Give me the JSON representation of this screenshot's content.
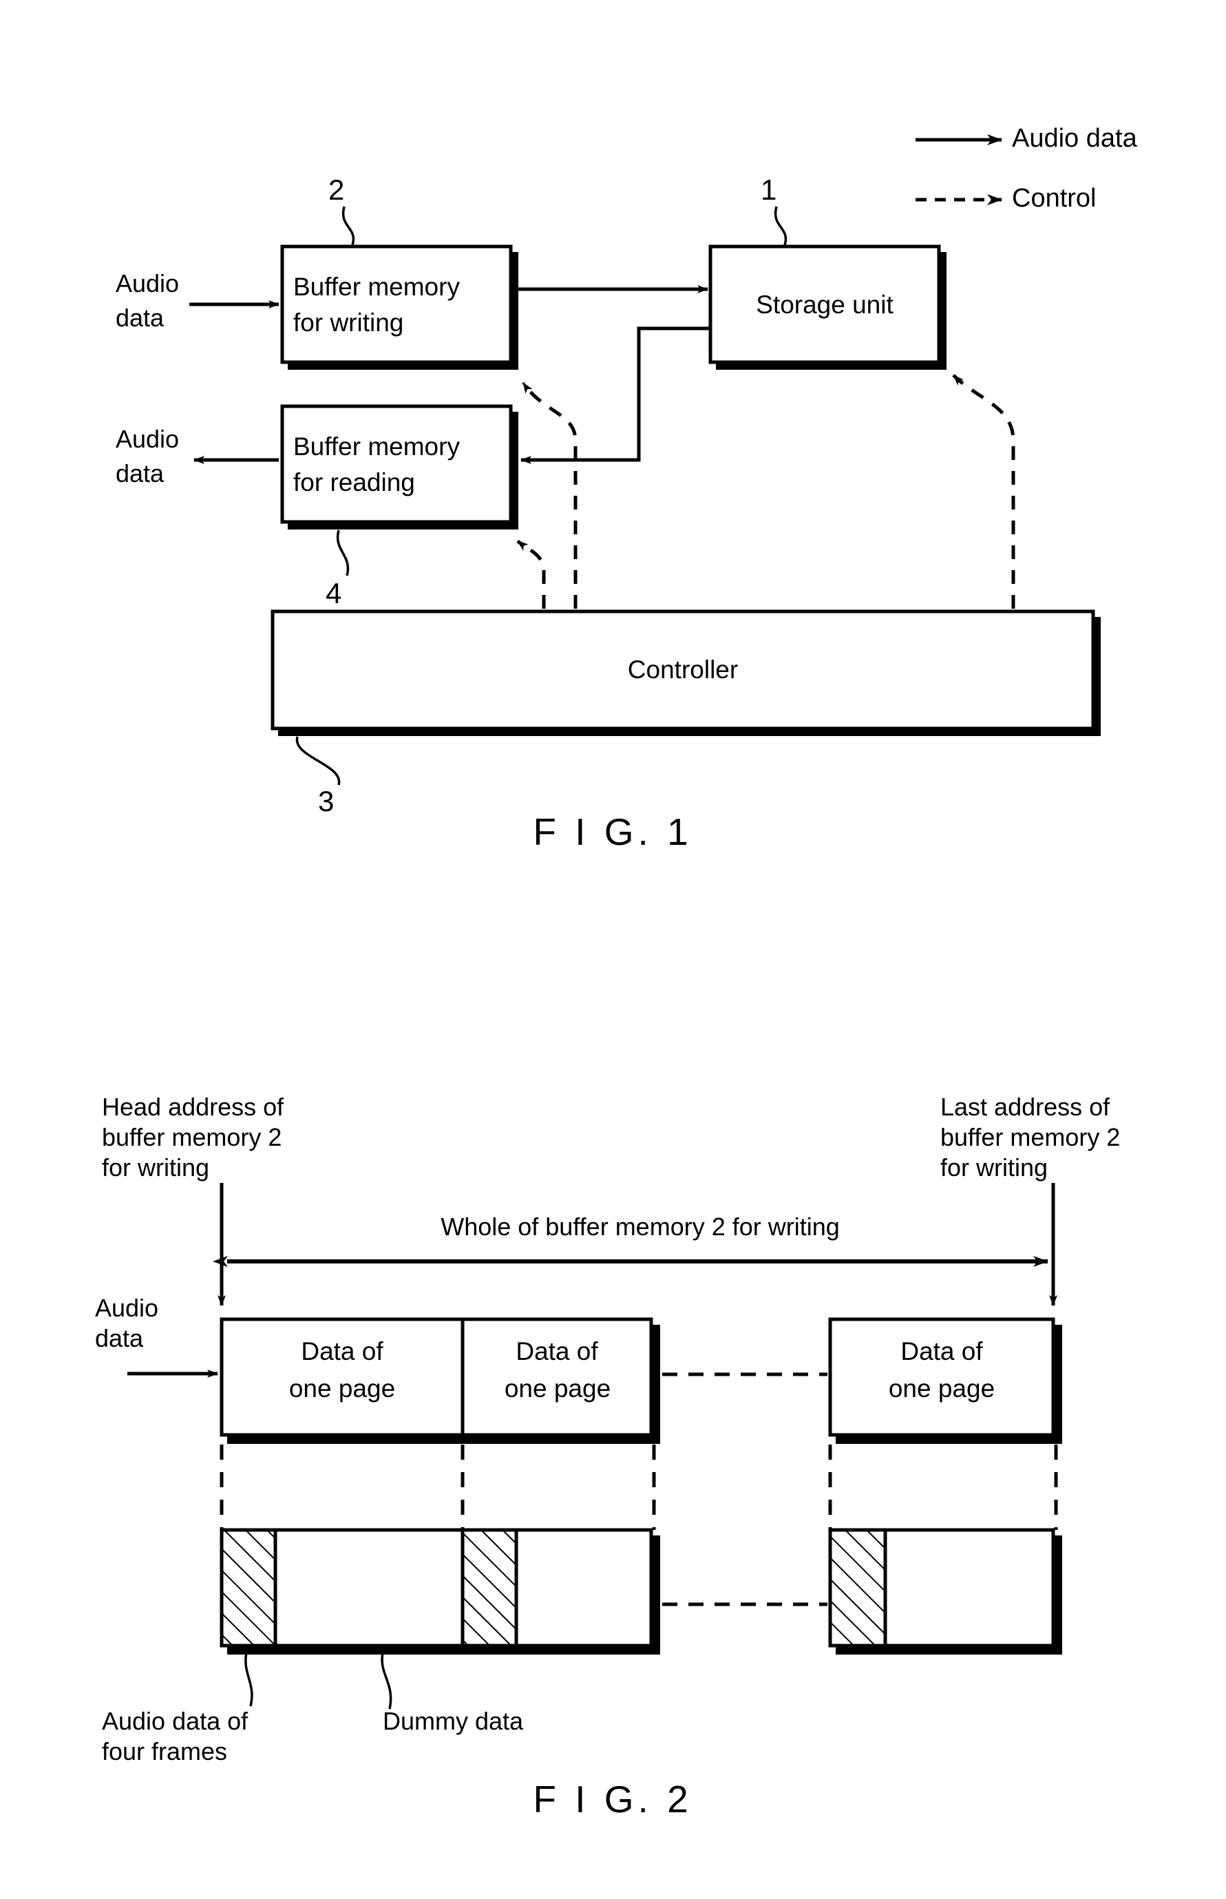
{
  "figure1": {
    "caption": "F I G. 1",
    "legend": [
      {
        "id": "audio-data",
        "label": "Audio data",
        "style": "solid"
      },
      {
        "id": "control",
        "label": "Control",
        "style": "dashed"
      }
    ],
    "blocks": [
      {
        "id": "buffer-write",
        "line1": "Buffer memory",
        "line2": "for writing",
        "ref": "2"
      },
      {
        "id": "storage-unit",
        "line1": "Storage unit",
        "line2": "",
        "ref": "1"
      },
      {
        "id": "buffer-read",
        "line1": "Buffer memory",
        "line2": "for reading",
        "ref": "4"
      },
      {
        "id": "controller",
        "line1": "Controller",
        "line2": "",
        "ref": "3"
      }
    ],
    "io_labels": [
      {
        "id": "input-audio",
        "line1": "Audio",
        "line2": "data"
      },
      {
        "id": "output-audio",
        "line1": "Audio",
        "line2": "data"
      }
    ]
  },
  "figure2": {
    "caption": "F I G. 2",
    "head_address_label": "Head address of\nbuffer memory 2\nfor writing",
    "last_address_label": "Last address of\nbuffer memory 2\nfor writing",
    "span_label": "Whole of buffer memory 2 for writing",
    "input_label": "Audio\ndata",
    "page_cells": [
      {
        "id": "page-1",
        "line1": "Data of",
        "line2": "one page"
      },
      {
        "id": "page-2",
        "line1": "Data of",
        "line2": "one page"
      },
      {
        "id": "page-n",
        "line1": "Data of",
        "line2": "one page"
      }
    ],
    "detail_labels": [
      {
        "id": "audio-frames",
        "text": "Audio data of\nfour frames"
      },
      {
        "id": "dummy-data",
        "text": "Dummy data"
      }
    ]
  },
  "colors": {
    "ink": "#000000",
    "paper": "#ffffff"
  }
}
